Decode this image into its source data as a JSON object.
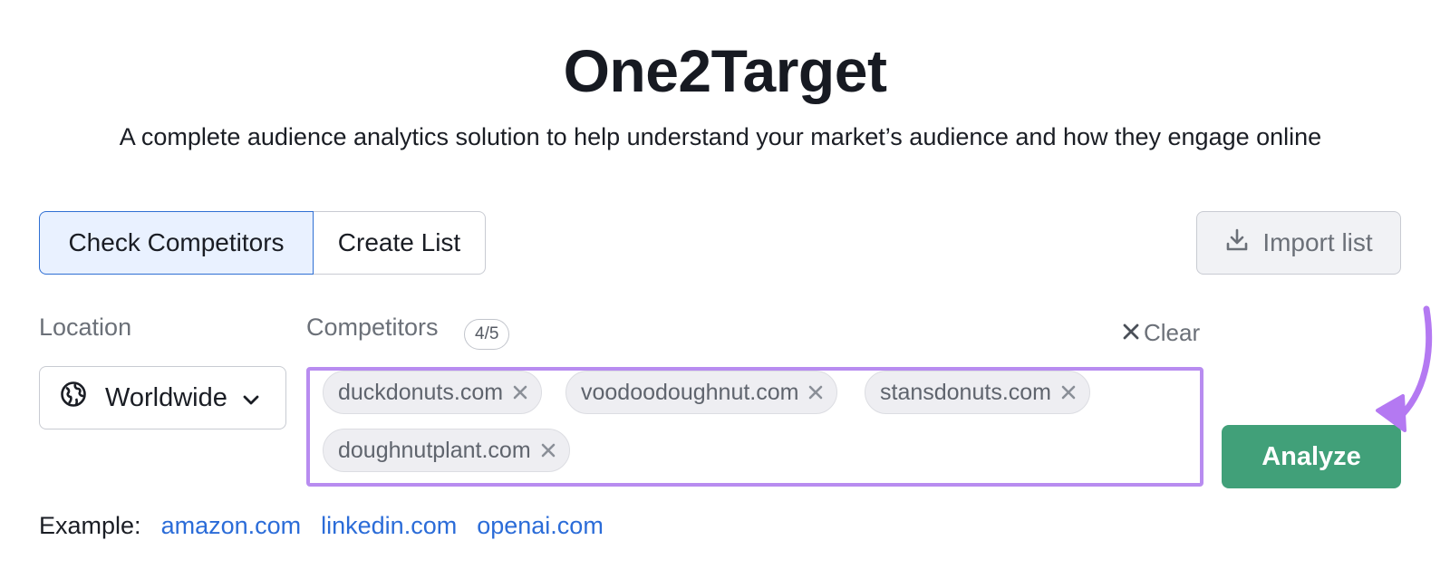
{
  "header": {
    "title": "One2Target",
    "subtitle": "A complete audience analytics solution to help understand your market’s audience and how they engage online"
  },
  "mode_tabs": [
    {
      "label": "Check Competitors",
      "active": true
    },
    {
      "label": "Create List",
      "active": false
    }
  ],
  "import": {
    "label": "Import list",
    "icon": "download-icon"
  },
  "location": {
    "label": "Location",
    "value": "Worldwide",
    "icon": "globe-icon"
  },
  "competitors": {
    "label": "Competitors",
    "count": "4/5",
    "clear_label": "Clear",
    "chips": [
      "duckdonuts.com",
      "voodoodoughnut.com",
      "stansdonuts.com",
      "doughnutplant.com"
    ]
  },
  "analyze": {
    "label": "Analyze"
  },
  "example": {
    "label": "Example:",
    "links": [
      "amazon.com",
      "linkedin.com",
      "openai.com"
    ]
  },
  "colors": {
    "accent_green": "#41a079",
    "highlight_purple": "#b88cf0",
    "link_blue": "#2b6cd8",
    "active_tab_bg": "#e9f1ff"
  }
}
